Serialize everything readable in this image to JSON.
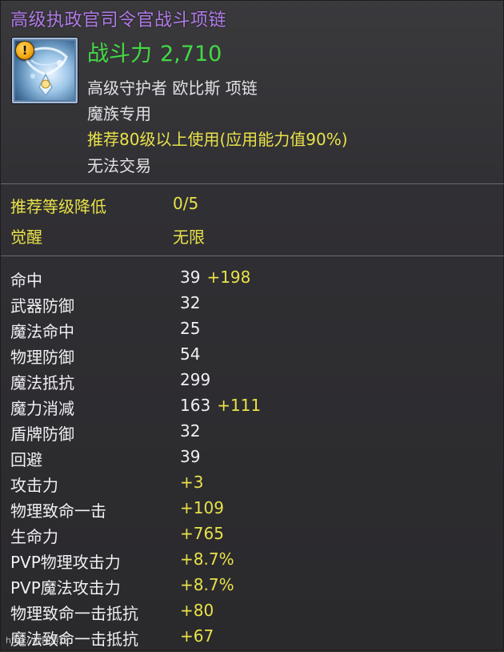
{
  "item": {
    "title": "高级执政官司令官战斗项链",
    "icon": "necklace-icon",
    "warning_icon": "warning-icon",
    "warning_glyph": "!",
    "combat_power_label": "战斗力",
    "combat_power_value": "2,710",
    "subtitle": "高级守护者 欧比斯 项链",
    "faction": "魔族专用",
    "level_requirement": "推荐80级以上使用(应用能力值90%)",
    "trade": "无法交易"
  },
  "upgrades": [
    {
      "label": "推荐等级降低",
      "value": "0/5"
    },
    {
      "label": "觉醒",
      "value": "无限"
    }
  ],
  "stats": [
    {
      "label": "命中",
      "base": "39",
      "bonus": "+198"
    },
    {
      "label": "武器防御",
      "base": "32",
      "bonus": ""
    },
    {
      "label": "魔法命中",
      "base": "25",
      "bonus": ""
    },
    {
      "label": "物理防御",
      "base": "54",
      "bonus": ""
    },
    {
      "label": "魔法抵抗",
      "base": "299",
      "bonus": ""
    },
    {
      "label": "魔力消减",
      "base": "163",
      "bonus": "+111"
    },
    {
      "label": "盾牌防御",
      "base": "32",
      "bonus": ""
    },
    {
      "label": "回避",
      "base": "39",
      "bonus": ""
    },
    {
      "label": "攻击力",
      "base": "+3",
      "bonus": ""
    },
    {
      "label": "物理致命一击",
      "base": "+109",
      "bonus": ""
    },
    {
      "label": "生命力",
      "base": "+765",
      "bonus": ""
    },
    {
      "label": "PVP物理攻击力",
      "base": "+8.7%",
      "bonus": ""
    },
    {
      "label": "PVP魔法攻击力",
      "base": "+8.7%",
      "bonus": ""
    },
    {
      "label": "物理致命一击抵抗",
      "base": "+80",
      "bonus": ""
    },
    {
      "label": "魔法致命一击抵抗",
      "base": "+67",
      "bonus": ""
    }
  ],
  "watermark": "http://战网游戏",
  "colors": {
    "title": "#b07be6",
    "combat_power": "#43d943",
    "highlight": "#e8e24a",
    "text": "#f1eff3",
    "background": "#2b2a2d"
  }
}
